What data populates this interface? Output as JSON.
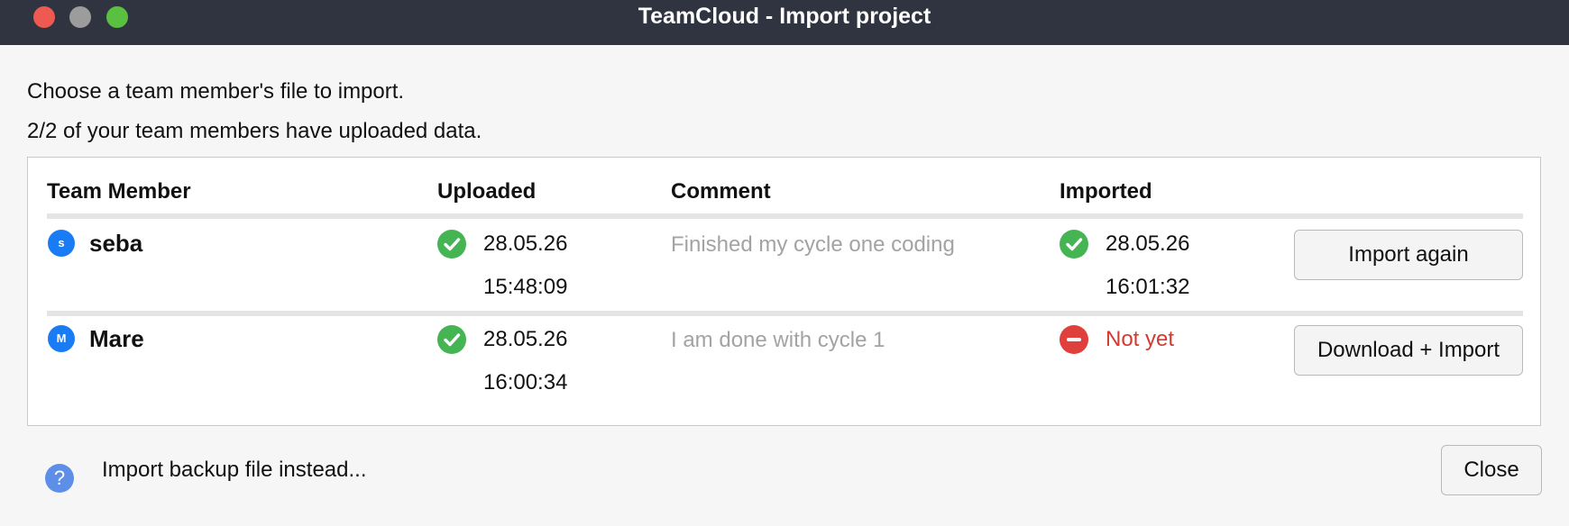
{
  "window": {
    "title": "TeamCloud - Import project"
  },
  "intro": {
    "line1": "Choose a team member's file to import.",
    "line2": "2/2 of your team members have uploaded data."
  },
  "table": {
    "headers": [
      "Team Member",
      "Uploaded",
      "Comment",
      "Imported"
    ],
    "rows": [
      {
        "initial": "s",
        "member": "seba",
        "uploaded_status": "check-icon",
        "uploaded_date": "28.05.26",
        "uploaded_time": "15:48:09",
        "comment": "Finished my cycle one coding",
        "imported_status": "check-icon",
        "imported_date": "28.05.26",
        "imported_time": "16:01:32",
        "action": "Import again"
      },
      {
        "initial": "M",
        "member": "Mare",
        "uploaded_status": "check-icon",
        "uploaded_date": "28.05.26",
        "uploaded_time": "16:00:34",
        "comment": "I am done with cycle 1",
        "imported_status": "minus-icon",
        "imported_text": "Not yet",
        "action": "Download + Import"
      }
    ]
  },
  "footer": {
    "help_icon": "?",
    "backup_link": "Import backup file instead...",
    "close_label": "Close"
  },
  "colors": {
    "titlebar": "#2f3440",
    "ok_green": "#45b553",
    "error_red": "#e0403c",
    "not_yet_text": "#d6392f",
    "avatar_blue": "#1a7cf5",
    "help_blue": "#5e8fe8"
  }
}
